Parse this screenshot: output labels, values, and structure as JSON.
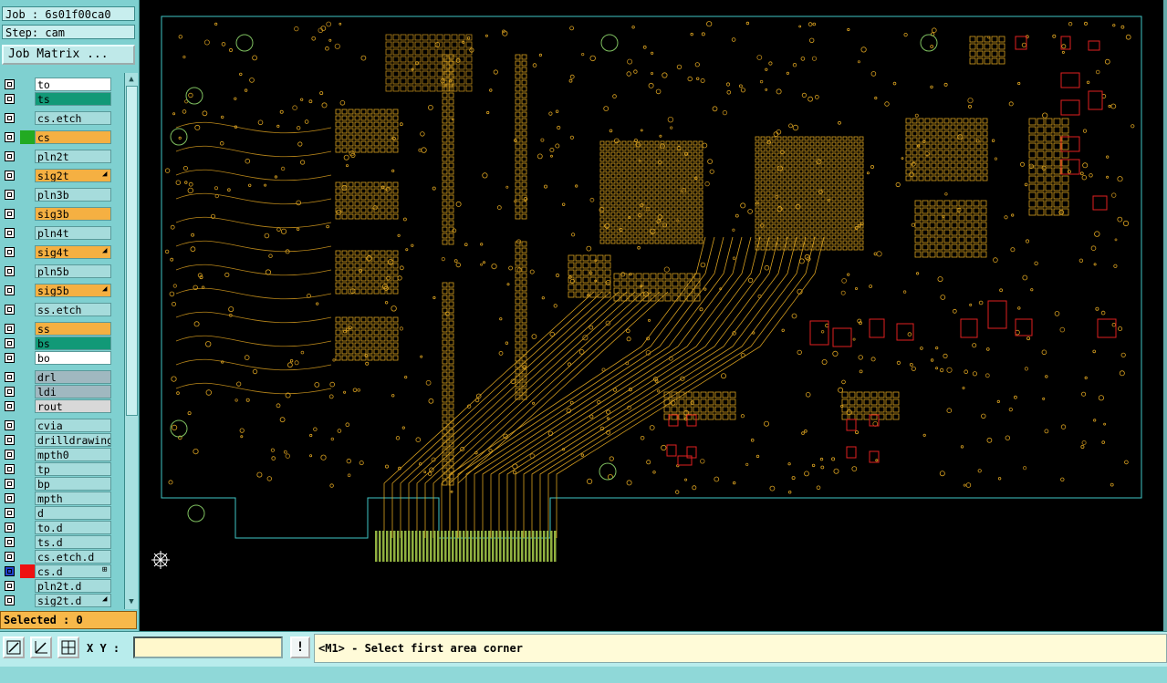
{
  "job_label": "Job : 6s01f00ca0",
  "step_label": "Step: cam",
  "job_matrix_button": "Job Matrix ...",
  "layers": [
    {
      "name": "to",
      "color": "#ffffff",
      "swatch": ""
    },
    {
      "name": "ts",
      "color": "#119977",
      "swatch": ""
    },
    {
      "name": "cs.etch",
      "color": "#a6dcdc",
      "swatch": ""
    },
    {
      "name": "cs",
      "color": "#f5b042",
      "swatch": "#22aa22"
    },
    {
      "name": "pln2t",
      "color": "#a6dcdc",
      "swatch": ""
    },
    {
      "name": "sig2t",
      "color": "#f5b042",
      "swatch": "",
      "mark": "◢"
    },
    {
      "name": "pln3b",
      "color": "#a6dcdc",
      "swatch": ""
    },
    {
      "name": "sig3b",
      "color": "#f5b042",
      "swatch": ""
    },
    {
      "name": "pln4t",
      "color": "#a6dcdc",
      "swatch": ""
    },
    {
      "name": "sig4t",
      "color": "#f5b042",
      "swatch": "",
      "mark": "◢"
    },
    {
      "name": "pln5b",
      "color": "#a6dcdc",
      "swatch": ""
    },
    {
      "name": "sig5b",
      "color": "#f5b042",
      "swatch": "",
      "mark": "◢"
    },
    {
      "name": "ss.etch",
      "color": "#a6dcdc",
      "swatch": ""
    },
    {
      "name": "ss",
      "color": "#f5b042",
      "swatch": ""
    },
    {
      "name": "bs",
      "color": "#119977",
      "swatch": ""
    },
    {
      "name": "bo",
      "color": "#ffffff",
      "swatch": ""
    },
    {
      "name": "drl",
      "color": "#a0b8c0",
      "swatch": ""
    },
    {
      "name": "ldi",
      "color": "#a0b8c0",
      "swatch": ""
    },
    {
      "name": "rout",
      "color": "#d8d8d8",
      "swatch": ""
    },
    {
      "name": "cvia",
      "color": "#a6dcdc",
      "swatch": ""
    },
    {
      "name": "drilldrawing",
      "color": "#a6dcdc",
      "swatch": ""
    },
    {
      "name": "mpth0",
      "color": "#a6dcdc",
      "swatch": ""
    },
    {
      "name": "tp",
      "color": "#a6dcdc",
      "swatch": ""
    },
    {
      "name": "bp",
      "color": "#a6dcdc",
      "swatch": ""
    },
    {
      "name": "mpth",
      "color": "#a6dcdc",
      "swatch": ""
    },
    {
      "name": "d",
      "color": "#a6dcdc",
      "swatch": ""
    },
    {
      "name": "to.d",
      "color": "#a6dcdc",
      "swatch": ""
    },
    {
      "name": "ts.d",
      "color": "#a6dcdc",
      "swatch": ""
    },
    {
      "name": "cs.etch.d",
      "color": "#a6dcdc",
      "swatch": ""
    },
    {
      "name": "cs.d",
      "color": "#a6dcdc",
      "swatch": "#ee1111",
      "mark": "⊞",
      "blue": true
    },
    {
      "name": "pln2t.d",
      "color": "#a6dcdc",
      "swatch": ""
    },
    {
      "name": "sig2t.d",
      "color": "#a6dcdc",
      "swatch": "",
      "mark": "◢"
    }
  ],
  "selected_label": "Selected : 0",
  "xy_label": "X Y :",
  "xy_value": "",
  "status_message": "<M1> - Select first area corner",
  "icons": [
    "zoom-area-icon",
    "measure-icon",
    "snap-grid-icon",
    "origin-crosshair-icon"
  ]
}
